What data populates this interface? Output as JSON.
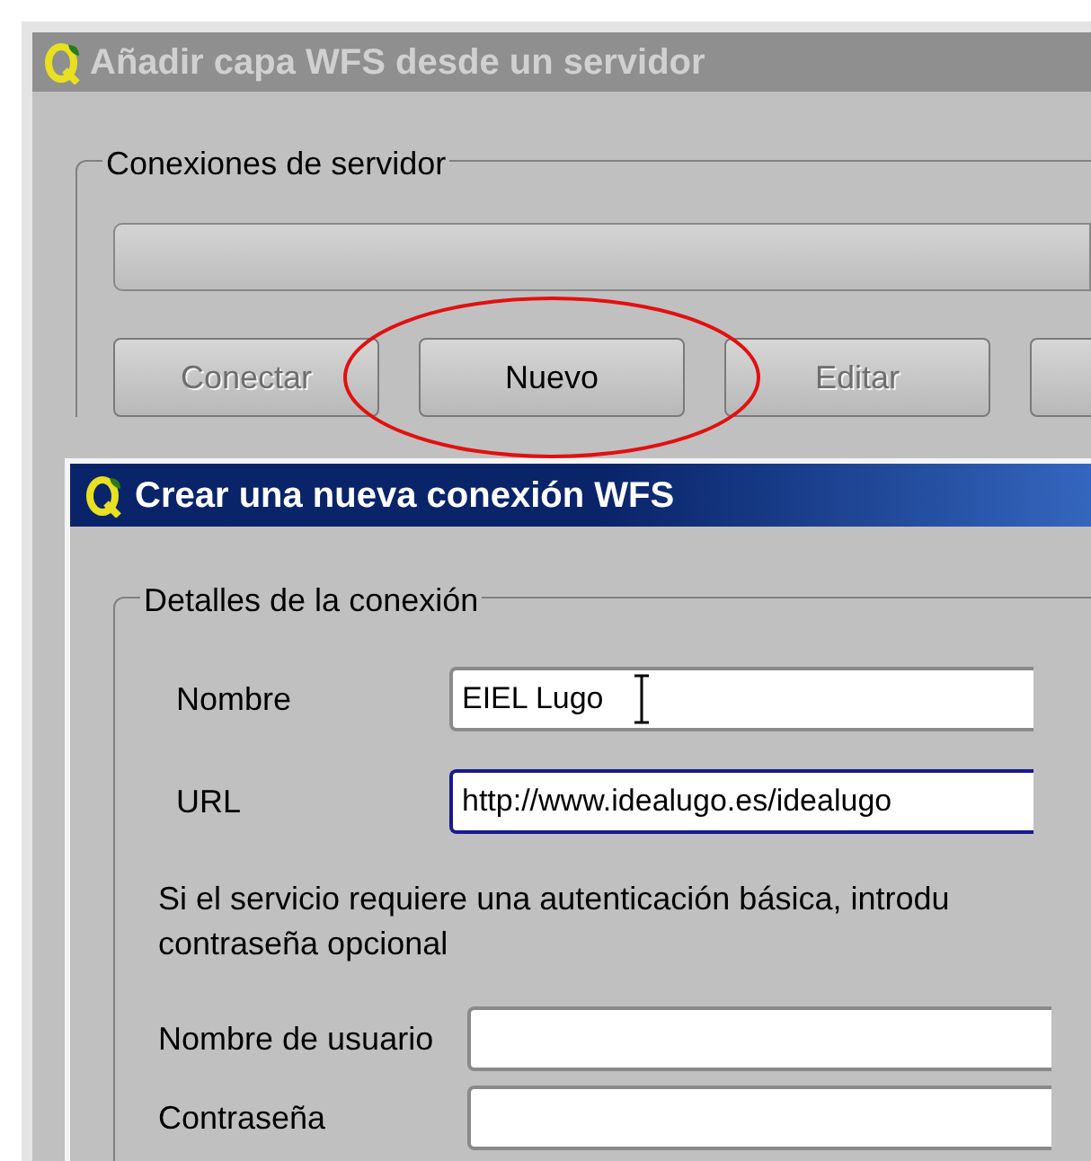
{
  "main_window": {
    "title": "Añadir capa WFS desde un servidor",
    "active": false
  },
  "server_connections": {
    "label": "Conexiones de servidor",
    "buttons": [
      {
        "label": "Conectar",
        "disabled": true,
        "circled": false
      },
      {
        "label": "Nuevo",
        "disabled": false,
        "circled": true
      },
      {
        "label": "Editar",
        "disabled": true,
        "circled": false
      }
    ]
  },
  "dialog": {
    "title": "Crear una nueva conexión WFS",
    "active": true,
    "group_label": "Detalles de la conexión",
    "fields": [
      {
        "label": "Nombre",
        "value": "EIEL Lugo",
        "focused": false,
        "text_cursor": true
      },
      {
        "label": "URL",
        "value": "http://www.idealugo.es/idealugo",
        "focused": true,
        "text_cursor": false
      }
    ],
    "note_lines": [
      "Si el servicio requiere una autenticación básica, introdu",
      "contraseña opcional"
    ],
    "credential_fields": [
      {
        "label": "Nombre de usuario"
      },
      {
        "label": "Contraseña"
      }
    ]
  }
}
